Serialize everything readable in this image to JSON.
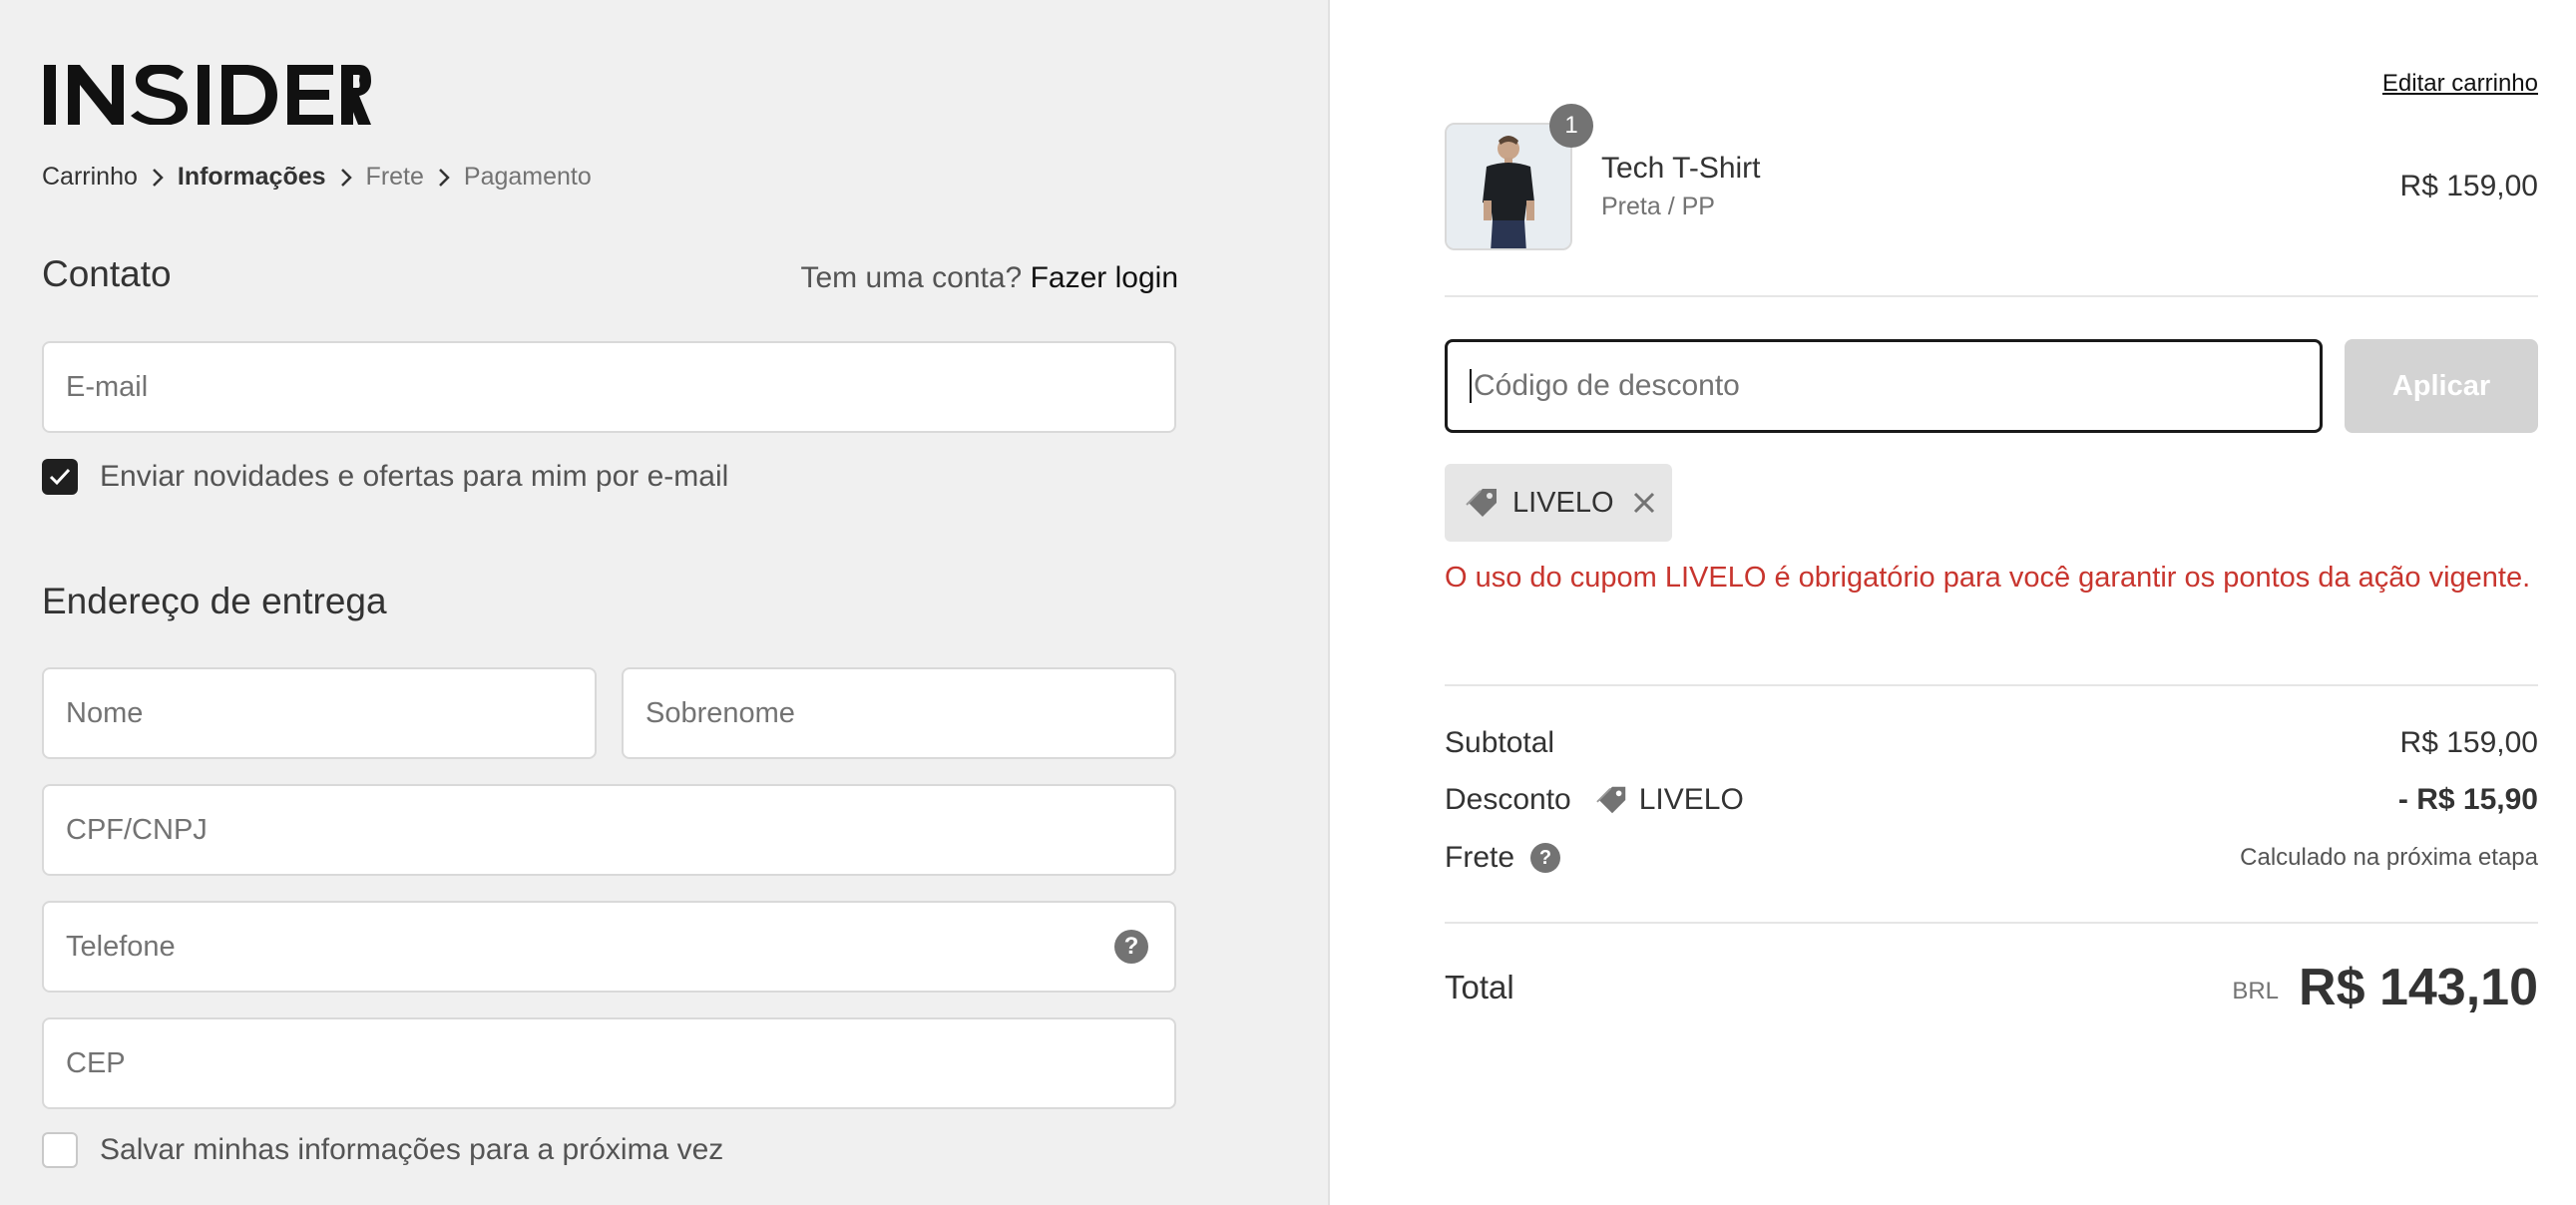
{
  "brand": {
    "logo_text": "INSIDER"
  },
  "breadcrumb": [
    {
      "label": "Carrinho",
      "state": "done"
    },
    {
      "label": "Informações",
      "state": "current"
    },
    {
      "label": "Frete",
      "state": "inactive"
    },
    {
      "label": "Pagamento",
      "state": "inactive"
    }
  ],
  "contact": {
    "title": "Contato",
    "has_account": "Tem uma conta?",
    "login_link": "Fazer login",
    "email_placeholder": "E-mail",
    "newsletter_label": "Enviar novidades e ofertas para mim por e-mail",
    "newsletter_checked": true
  },
  "shipping": {
    "title": "Endereço de entrega",
    "first_name_placeholder": "Nome",
    "last_name_placeholder": "Sobrenome",
    "cpf_placeholder": "CPF/CNPJ",
    "phone_placeholder": "Telefone",
    "cep_placeholder": "CEP",
    "save_info_label": "Salvar minhas informações para a próxima vez",
    "save_info_checked": false
  },
  "cart": {
    "edit_link": "Editar carrinho",
    "item": {
      "quantity": "1",
      "name": "Tech T-Shirt",
      "variant": "Preta / PP",
      "price": "R$ 159,00"
    },
    "discount_placeholder": "Código de desconto",
    "apply_label": "Aplicar",
    "applied_code": "LIVELO",
    "error_message": "O uso do cupom LIVELO é obrigatório para você garantir os pontos da ação vigente."
  },
  "summary": {
    "subtotal_label": "Subtotal",
    "subtotal_value": "R$ 159,00",
    "discount_label": "Desconto",
    "discount_code": "LIVELO",
    "discount_value": "- R$ 15,90",
    "shipping_label": "Frete",
    "shipping_value": "Calculado na próxima etapa",
    "total_label": "Total",
    "currency": "BRL",
    "total_value": "R$ 143,10"
  },
  "colors": {
    "error": "#c8352e",
    "left_bg": "#f0f0f0",
    "checkbox_checked": "#1f1f1f",
    "apply_disabled": "#d3d3d3"
  }
}
